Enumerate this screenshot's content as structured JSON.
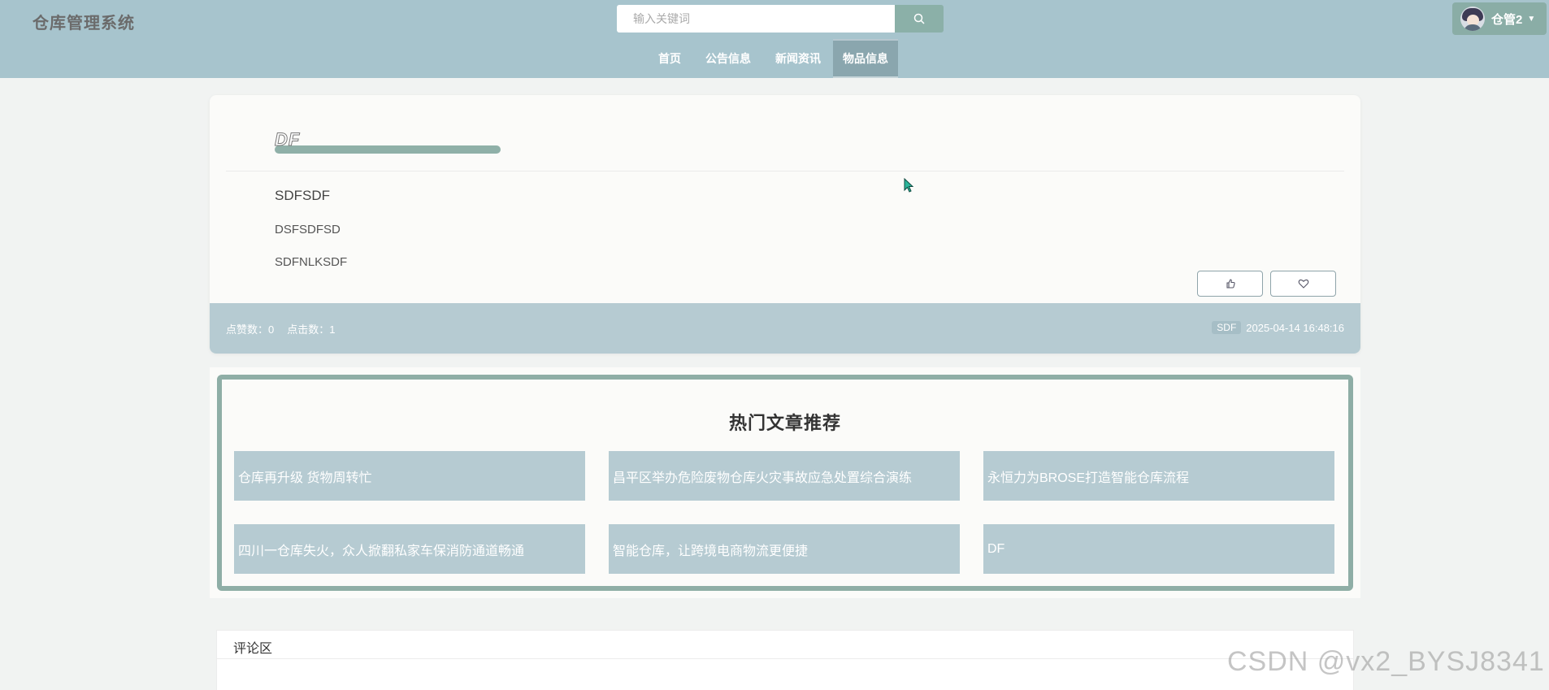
{
  "header": {
    "brand": "仓库管理系统",
    "search_placeholder": "输入关键词",
    "user_name": "仓管2",
    "nav": [
      {
        "label": "首页",
        "active": false
      },
      {
        "label": "公告信息",
        "active": false
      },
      {
        "label": "新闻资讯",
        "active": false
      },
      {
        "label": "物品信息",
        "active": true
      }
    ]
  },
  "article": {
    "title": "DF",
    "lines": [
      "SDFSDF",
      "DSFSDFSD",
      "SDFNLKSDF"
    ],
    "like_icon": "thumb-up-icon",
    "favorite_icon": "heart-icon",
    "stats": {
      "likes": "点赞数：0",
      "clicks": "点击数：1"
    },
    "author": "SDF",
    "datetime": "2025-04-14 16:48:16"
  },
  "hot": {
    "title": "热门文章推荐",
    "items": [
      "仓库再升级 货物周转忙",
      "昌平区举办危险废物仓库火灾事故应急处置综合演练",
      "永恒力为BROSE打造智能仓库流程",
      "四川一仓库失火，众人掀翻私家车保消防通道畅通",
      "智能仓库，让跨境电商物流更便捷",
      "DF"
    ]
  },
  "comments": {
    "title": "评论区"
  },
  "watermark": "CSDN @vx2_BYSJ8341",
  "colors": {
    "header_bg": "#a7c4cd",
    "accent": "#8faea6",
    "tile_bg": "#b6cbd2"
  }
}
